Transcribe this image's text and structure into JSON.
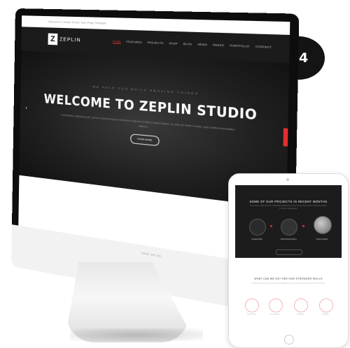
{
  "badge": {
    "number": "04"
  },
  "desktop": {
    "topbar_text": "Welcome to Zeplin Studio Tech Page Template",
    "logo_letter": "Z",
    "logo_text": "ZEPLIN",
    "menu": [
      "HOME",
      "FEATURES",
      "PROJECTS",
      "SHOP",
      "BLOG",
      "NEWS",
      "PAGES",
      "PORTFOLIO",
      "CONTACT"
    ],
    "hero": {
      "pretitle": "WE HELP YOU BUILD AMAZING THINGS",
      "title": "WELCOME TO ZEPLIN STUDIO",
      "description": "Consectetur adipisicing elit, sed do eiusmod tempor incididunt ut labore et dolore magna aliqua. Ut enim ad minim veniam, quis nostrud exercitation ullamco.",
      "cta": "KNOW MORE"
    },
    "chin_label": "WHAT WE DO"
  },
  "tablet": {
    "projects_heading": "SOME OF OUR PROJECTS IN RECENT MONTHS",
    "projects_sub": "Lorem ipsum dolor sit amet, consectetur adipisicing elit. Sed do eiusmod tempor incididunt ut labore et dolore magna aliqua.",
    "project_captions": [
      "Creative Mind",
      "Technical Everything",
      "Great Interface"
    ],
    "skills_heading": "WHAT CAN WE DO? SEE OUR STRONGER SKILLS",
    "skills_sub": "Lorem ipsum dolor sit amet, consectetur adipisicing elit, sed do eiusmod tempor incididunt ut labore.",
    "skill_labels": [
      "Web Design",
      "Development",
      "Marketing",
      "Branding"
    ]
  },
  "colors": {
    "accent": "#e0312f",
    "dark": "#1b1b1b"
  }
}
